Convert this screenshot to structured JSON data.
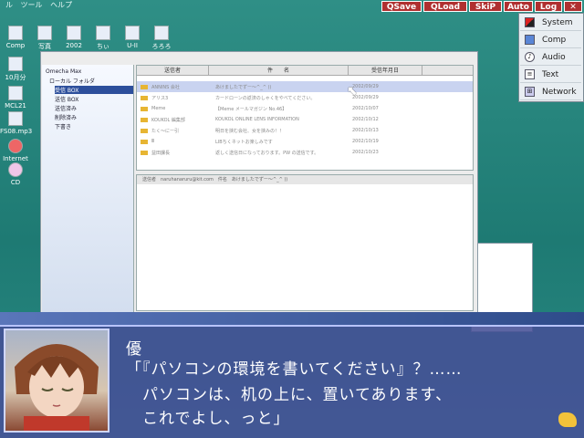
{
  "menu": {
    "items": [
      "ル",
      "ツール",
      "ヘルプ"
    ]
  },
  "desktop": {
    "icons": [
      {
        "label": "Comp"
      },
      {
        "label": "写真"
      },
      {
        "label": "2002"
      },
      {
        "label": "ちぃ"
      },
      {
        "label": "U-II"
      },
      {
        "label": "ろろろ"
      },
      {
        "label": "10月分"
      },
      {
        "label": "MCL21"
      },
      {
        "label": "FS08.mp3"
      },
      {
        "label": "Internet"
      },
      {
        "label": "CD"
      }
    ]
  },
  "right_panel": {
    "items": [
      "System",
      "Comp",
      "Audio",
      "Text",
      "Network"
    ]
  },
  "mail": {
    "app_title": "Omecha Max",
    "tree": [
      "ローカル フォルダ",
      "受信 BOX",
      "送信 BOX",
      "送信済み",
      "削除済み",
      "下書き"
    ],
    "columns": [
      "送信者",
      "件　　名",
      "受信年月日"
    ],
    "rows": [
      {
        "from": "ANNINS 会社",
        "subject": "あけましたでずー〜^_^ ))",
        "date": "2002/09/29"
      },
      {
        "from": "アリス3",
        "subject": "カードローンの返済のしゃくをやべてください。",
        "date": "2002/09/29"
      },
      {
        "from": "Meme",
        "subject": "【Meme メールマガジン No.46】",
        "date": "2002/10/07"
      },
      {
        "from": "KOUKOL 編集部",
        "subject": "KOUKOL ONLINE LENS INFORMATION",
        "date": "2002/10/12"
      },
      {
        "from": "たく〜にー引",
        "subject": "明日を挟む会社、女を挟みの！！",
        "date": "2002/10/13"
      },
      {
        "from": "Ⅲ",
        "subject": "LIBちくネットお楽しみです",
        "date": "2002/10/19"
      },
      {
        "from": "益田課長",
        "subject": "返しく送信日になっております。PW の送信です。",
        "date": "2002/10/23"
      }
    ],
    "preview_header": "送信者　naruhanaruru@kit.com　件名　あけましたでずー〜^_^ ))"
  },
  "controls": {
    "qsave": "QSave",
    "qload": "QLoad",
    "skip": "SkiP",
    "auto": "Auto",
    "log": "Log",
    "close": "✕"
  },
  "dialog": {
    "speaker": "優",
    "lines": [
      "「『パソコンの環境を書いてください』？……",
      "　パソコンは、机の上に、置いてあります、",
      "　これでよし、っと」"
    ]
  },
  "colors": {
    "desktop": "#1e7a73",
    "dialog": "#464f96",
    "accent": "#b03030"
  }
}
